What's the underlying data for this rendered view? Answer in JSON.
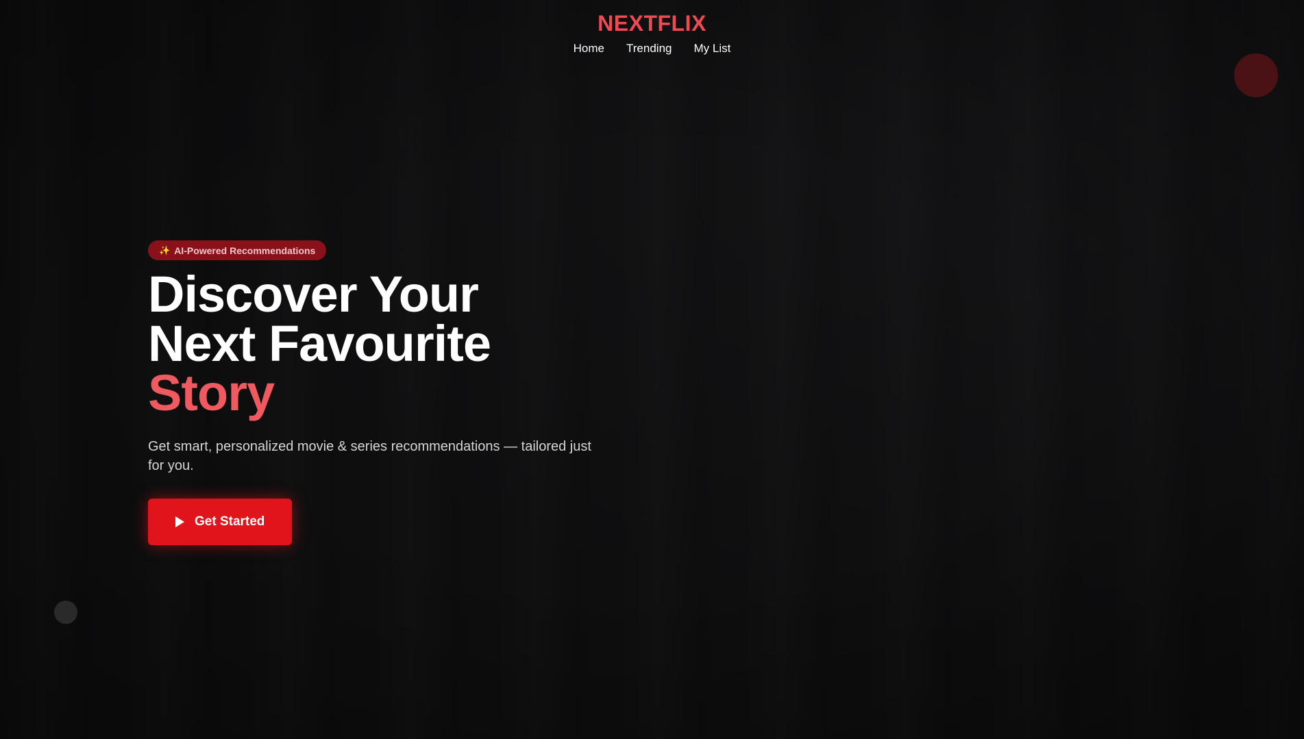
{
  "header": {
    "brand": "NEXTFLIX",
    "nav": [
      {
        "label": "Home"
      },
      {
        "label": "Trending"
      },
      {
        "label": "My List"
      }
    ]
  },
  "hero": {
    "badge": {
      "icon": "sparkles-icon",
      "label": "AI-Powered Recommendations"
    },
    "title_line1": "Discover Your",
    "title_line2": "Next Favourite",
    "title_accent": "Story",
    "subtitle": "Get smart, personalized movie & series recommendations — tailored just for you.",
    "cta": {
      "icon": "play-icon",
      "label": "Get Started"
    }
  },
  "colors": {
    "brand": "#ef4a52",
    "accent": "#ef5a60",
    "cta": "#e2141b",
    "background": "#0f0f10"
  }
}
